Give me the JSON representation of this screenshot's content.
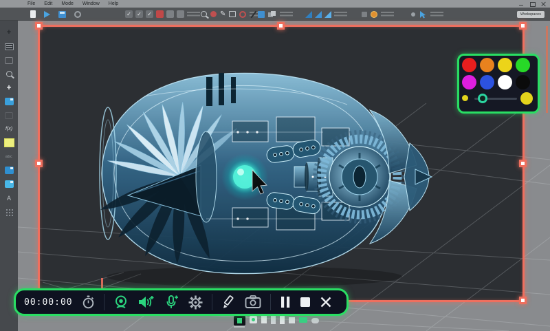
{
  "menu": {
    "items": [
      "File",
      "Edit",
      "Mode",
      "Window",
      "Help"
    ]
  },
  "toolbar": {
    "workspaces_label": "Workspaces"
  },
  "window_controls": {
    "icons": [
      "minimize-icon",
      "maximize-icon",
      "close-icon"
    ]
  },
  "sidebar": {
    "fx_label": "f(x)",
    "abc_label": "abc",
    "letter_a_label": "A",
    "plus_label": "+",
    "cross_label": "+",
    "icons": [
      "move-tool-icon",
      "layers-panel-icon",
      "wrench-tool-icon",
      "zoom-magnifier-icon",
      "transform-plus-icon",
      "annotate-tool-icon",
      "ghost-tool-icon",
      "function-fx-icon",
      "active-color-swatch",
      "text-abc-icon",
      "material-blue-icon",
      "material-cyan-icon",
      "compass-a-icon",
      "grid-dots-icon"
    ]
  },
  "viewport": {
    "model_name": "jet-engine-xray-render",
    "background": "#2c2f33"
  },
  "capture_selection": {
    "border_color": "#ef6f5e",
    "handles": [
      "top-left",
      "top-center",
      "top-right",
      "middle-left",
      "middle-right",
      "bottom-right"
    ]
  },
  "palette": {
    "border_color": "#29de63",
    "colors": [
      "#e81e1e",
      "#e8821e",
      "#ecd419",
      "#27d827",
      "#df1edf",
      "#2c52e0",
      "#ffffff",
      "#0b0b0b"
    ],
    "small_dot_color": "#e3d41c",
    "preview_color": "#e3d41c",
    "slider_handle_color": "#2bd4a0"
  },
  "recorder": {
    "timer": "00:00:00",
    "border_color": "#29de63",
    "icons": [
      "stopwatch-icon",
      "webcam-icon",
      "speaker-plus-icon",
      "microphone-plus-icon",
      "settings-gear-icon",
      "pencil-icon",
      "screenshot-camera-icon",
      "pause-icon",
      "stop-icon",
      "close-icon"
    ],
    "accent_green": "#2bd47e"
  }
}
